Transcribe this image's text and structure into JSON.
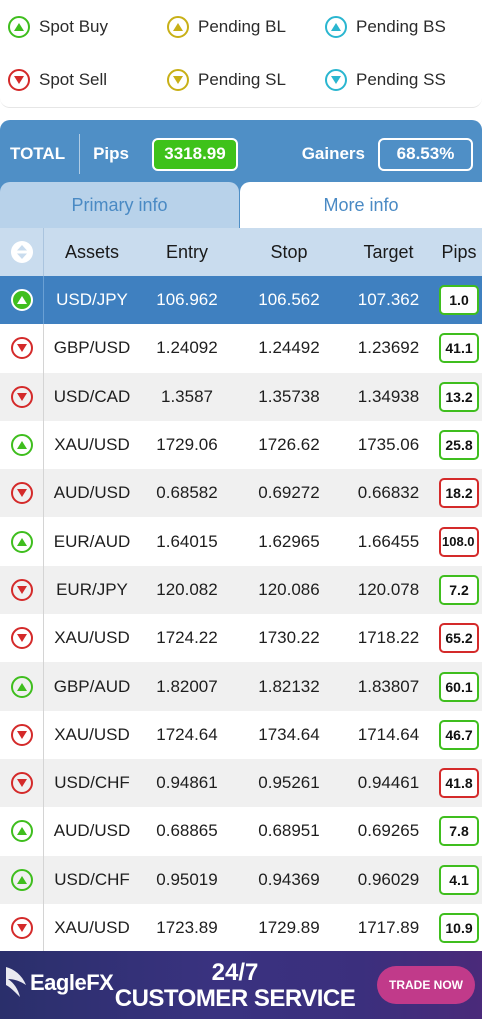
{
  "legend": [
    {
      "label": "Spot Buy",
      "color": "#3fbe1e",
      "dir": "up"
    },
    {
      "label": "Pending BL",
      "color": "#c8b017",
      "dir": "up"
    },
    {
      "label": "Pending BS",
      "color": "#2ab6d0",
      "dir": "up"
    },
    {
      "label": "Spot Sell",
      "color": "#d42a2a",
      "dir": "down"
    },
    {
      "label": "Pending SL",
      "color": "#c8b017",
      "dir": "down"
    },
    {
      "label": "Pending SS",
      "color": "#2ab6d0",
      "dir": "down"
    }
  ],
  "summary": {
    "total_label": "TOTAL",
    "pips_label": "Pips",
    "pips_value": "3318.99",
    "gainers_label": "Gainers",
    "gainers_value": "68.53%"
  },
  "tabs": {
    "primary": "Primary info",
    "more": "More info",
    "active": "primary"
  },
  "table": {
    "headers": {
      "assets": "Assets",
      "entry": "Entry",
      "stop": "Stop",
      "target": "Target",
      "pips": "Pips"
    },
    "rows": [
      {
        "dir": "up",
        "asset": "USD/JPY",
        "entry": "106.962",
        "stop": "106.562",
        "target": "107.362",
        "pips": "1.0",
        "pips_status": "gain",
        "selected": true
      },
      {
        "dir": "down",
        "asset": "GBP/USD",
        "entry": "1.24092",
        "stop": "1.24492",
        "target": "1.23692",
        "pips": "41.1",
        "pips_status": "gain"
      },
      {
        "dir": "down",
        "asset": "USD/CAD",
        "entry": "1.3587",
        "stop": "1.35738",
        "target": "1.34938",
        "pips": "13.2",
        "pips_status": "gain"
      },
      {
        "dir": "up",
        "asset": "XAU/USD",
        "entry": "1729.06",
        "stop": "1726.62",
        "target": "1735.06",
        "pips": "25.8",
        "pips_status": "gain"
      },
      {
        "dir": "down",
        "asset": "AUD/USD",
        "entry": "0.68582",
        "stop": "0.69272",
        "target": "0.66832",
        "pips": "18.2",
        "pips_status": "loss"
      },
      {
        "dir": "up",
        "asset": "EUR/AUD",
        "entry": "1.64015",
        "stop": "1.62965",
        "target": "1.66455",
        "pips": "108.0",
        "pips_status": "loss"
      },
      {
        "dir": "down",
        "asset": "EUR/JPY",
        "entry": "120.082",
        "stop": "120.086",
        "target": "120.078",
        "pips": "7.2",
        "pips_status": "gain"
      },
      {
        "dir": "down",
        "asset": "XAU/USD",
        "entry": "1724.22",
        "stop": "1730.22",
        "target": "1718.22",
        "pips": "65.2",
        "pips_status": "loss"
      },
      {
        "dir": "up",
        "asset": "GBP/AUD",
        "entry": "1.82007",
        "stop": "1.82132",
        "target": "1.83807",
        "pips": "60.1",
        "pips_status": "gain"
      },
      {
        "dir": "down",
        "asset": "XAU/USD",
        "entry": "1724.64",
        "stop": "1734.64",
        "target": "1714.64",
        "pips": "46.7",
        "pips_status": "gain"
      },
      {
        "dir": "down",
        "asset": "USD/CHF",
        "entry": "0.94861",
        "stop": "0.95261",
        "target": "0.94461",
        "pips": "41.8",
        "pips_status": "loss"
      },
      {
        "dir": "up",
        "asset": "AUD/USD",
        "entry": "0.68865",
        "stop": "0.68951",
        "target": "0.69265",
        "pips": "7.8",
        "pips_status": "gain"
      },
      {
        "dir": "up",
        "asset": "USD/CHF",
        "entry": "0.95019",
        "stop": "0.94369",
        "target": "0.96029",
        "pips": "4.1",
        "pips_status": "gain"
      },
      {
        "dir": "down",
        "asset": "XAU/USD",
        "entry": "1723.89",
        "stop": "1729.89",
        "target": "1717.89",
        "pips": "10.9",
        "pips_status": "gain"
      }
    ]
  },
  "ad": {
    "brand": "EagleFX",
    "headline_1": "24/7",
    "headline_2": "CUSTOMER SERVICE",
    "cta": "TRADE NOW"
  },
  "colors": {
    "accent": "#4f8fc6",
    "selected_row": "#3f80c0",
    "gain": "#3fbe1e",
    "loss": "#d42a2a"
  }
}
